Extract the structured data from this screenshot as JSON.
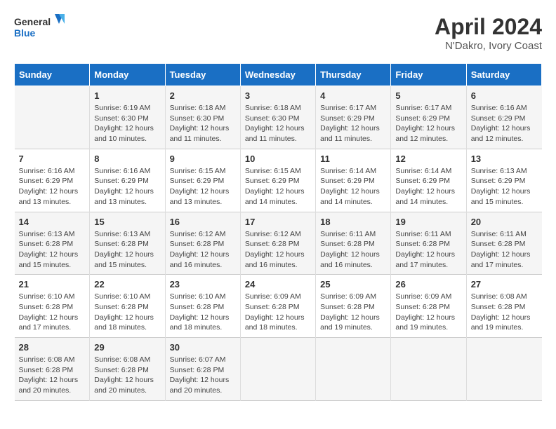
{
  "header": {
    "logo_general": "General",
    "logo_blue": "Blue",
    "title": "April 2024",
    "subtitle": "N'Dakro, Ivory Coast"
  },
  "days_of_week": [
    "Sunday",
    "Monday",
    "Tuesday",
    "Wednesday",
    "Thursday",
    "Friday",
    "Saturday"
  ],
  "weeks": [
    [
      {
        "day": "",
        "info": ""
      },
      {
        "day": "1",
        "info": "Sunrise: 6:19 AM\nSunset: 6:30 PM\nDaylight: 12 hours and 10 minutes."
      },
      {
        "day": "2",
        "info": "Sunrise: 6:18 AM\nSunset: 6:30 PM\nDaylight: 12 hours and 11 minutes."
      },
      {
        "day": "3",
        "info": "Sunrise: 6:18 AM\nSunset: 6:30 PM\nDaylight: 12 hours and 11 minutes."
      },
      {
        "day": "4",
        "info": "Sunrise: 6:17 AM\nSunset: 6:29 PM\nDaylight: 12 hours and 11 minutes."
      },
      {
        "day": "5",
        "info": "Sunrise: 6:17 AM\nSunset: 6:29 PM\nDaylight: 12 hours and 12 minutes."
      },
      {
        "day": "6",
        "info": "Sunrise: 6:16 AM\nSunset: 6:29 PM\nDaylight: 12 hours and 12 minutes."
      }
    ],
    [
      {
        "day": "7",
        "info": "Sunrise: 6:16 AM\nSunset: 6:29 PM\nDaylight: 12 hours and 13 minutes."
      },
      {
        "day": "8",
        "info": "Sunrise: 6:16 AM\nSunset: 6:29 PM\nDaylight: 12 hours and 13 minutes."
      },
      {
        "day": "9",
        "info": "Sunrise: 6:15 AM\nSunset: 6:29 PM\nDaylight: 12 hours and 13 minutes."
      },
      {
        "day": "10",
        "info": "Sunrise: 6:15 AM\nSunset: 6:29 PM\nDaylight: 12 hours and 14 minutes."
      },
      {
        "day": "11",
        "info": "Sunrise: 6:14 AM\nSunset: 6:29 PM\nDaylight: 12 hours and 14 minutes."
      },
      {
        "day": "12",
        "info": "Sunrise: 6:14 AM\nSunset: 6:29 PM\nDaylight: 12 hours and 14 minutes."
      },
      {
        "day": "13",
        "info": "Sunrise: 6:13 AM\nSunset: 6:29 PM\nDaylight: 12 hours and 15 minutes."
      }
    ],
    [
      {
        "day": "14",
        "info": "Sunrise: 6:13 AM\nSunset: 6:28 PM\nDaylight: 12 hours and 15 minutes."
      },
      {
        "day": "15",
        "info": "Sunrise: 6:13 AM\nSunset: 6:28 PM\nDaylight: 12 hours and 15 minutes."
      },
      {
        "day": "16",
        "info": "Sunrise: 6:12 AM\nSunset: 6:28 PM\nDaylight: 12 hours and 16 minutes."
      },
      {
        "day": "17",
        "info": "Sunrise: 6:12 AM\nSunset: 6:28 PM\nDaylight: 12 hours and 16 minutes."
      },
      {
        "day": "18",
        "info": "Sunrise: 6:11 AM\nSunset: 6:28 PM\nDaylight: 12 hours and 16 minutes."
      },
      {
        "day": "19",
        "info": "Sunrise: 6:11 AM\nSunset: 6:28 PM\nDaylight: 12 hours and 17 minutes."
      },
      {
        "day": "20",
        "info": "Sunrise: 6:11 AM\nSunset: 6:28 PM\nDaylight: 12 hours and 17 minutes."
      }
    ],
    [
      {
        "day": "21",
        "info": "Sunrise: 6:10 AM\nSunset: 6:28 PM\nDaylight: 12 hours and 17 minutes."
      },
      {
        "day": "22",
        "info": "Sunrise: 6:10 AM\nSunset: 6:28 PM\nDaylight: 12 hours and 18 minutes."
      },
      {
        "day": "23",
        "info": "Sunrise: 6:10 AM\nSunset: 6:28 PM\nDaylight: 12 hours and 18 minutes."
      },
      {
        "day": "24",
        "info": "Sunrise: 6:09 AM\nSunset: 6:28 PM\nDaylight: 12 hours and 18 minutes."
      },
      {
        "day": "25",
        "info": "Sunrise: 6:09 AM\nSunset: 6:28 PM\nDaylight: 12 hours and 19 minutes."
      },
      {
        "day": "26",
        "info": "Sunrise: 6:09 AM\nSunset: 6:28 PM\nDaylight: 12 hours and 19 minutes."
      },
      {
        "day": "27",
        "info": "Sunrise: 6:08 AM\nSunset: 6:28 PM\nDaylight: 12 hours and 19 minutes."
      }
    ],
    [
      {
        "day": "28",
        "info": "Sunrise: 6:08 AM\nSunset: 6:28 PM\nDaylight: 12 hours and 20 minutes."
      },
      {
        "day": "29",
        "info": "Sunrise: 6:08 AM\nSunset: 6:28 PM\nDaylight: 12 hours and 20 minutes."
      },
      {
        "day": "30",
        "info": "Sunrise: 6:07 AM\nSunset: 6:28 PM\nDaylight: 12 hours and 20 minutes."
      },
      {
        "day": "",
        "info": ""
      },
      {
        "day": "",
        "info": ""
      },
      {
        "day": "",
        "info": ""
      },
      {
        "day": "",
        "info": ""
      }
    ]
  ]
}
